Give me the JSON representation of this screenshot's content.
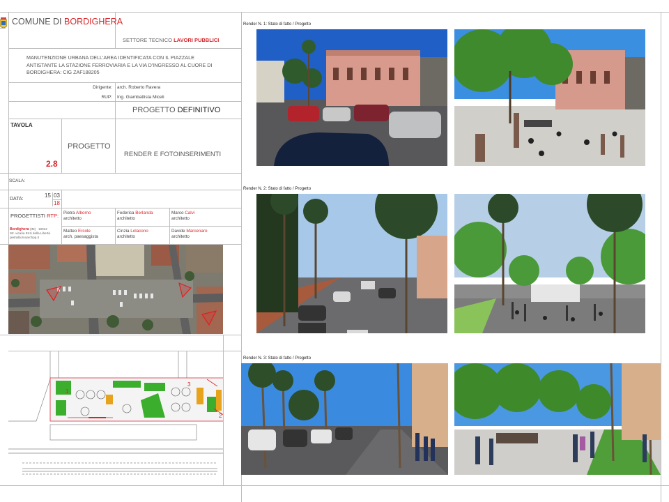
{
  "titleblock": {
    "comune_prefix": "COMUNE DI",
    "comune_name": "BORDIGHERA",
    "settore_prefix": "SETTORE TECNICO",
    "settore_name": "LAVORI PUBBLICI",
    "description_lines": [
      "MANUTENZIONE URBANA DELL'AREA IDENTIFICATA CON IL PIAZZALE",
      "ANTISTANTE LA STAZIONE FERROVIARIA E LA VIA D'INGRESSO AL CUORE DI",
      "BORDIGHERA:     CIG ZAF188205"
    ],
    "dirigente_label": "Dirigente:",
    "dirigente_value": "arch. Roberto Ravera",
    "rup_label": "RUP:",
    "rup_value": "Ing. Giambattista Miceli",
    "progetto_prefix": "PROGETTO",
    "progetto_type": "DEFINITIVO",
    "tavola_label": "TAVOLA",
    "tavola_number": "2.8",
    "section_label": "PROGETTO",
    "render_label": "RENDER E FOTOINSERIMENTI",
    "scala_label": "SCALA:",
    "data_label": "DATA:",
    "data_day": "15",
    "data_month": "03",
    "data_year": "18",
    "progettisti_label": "PROGETTISTI",
    "rtp_label": "RTP:",
    "designers": [
      {
        "first": "Pietra",
        "last": "Alborno",
        "role": "architetto"
      },
      {
        "first": "Federica",
        "last": "Berlanda",
        "role": "architetto"
      },
      {
        "first": "Marco",
        "last": "Calvi",
        "role": "architetto"
      },
      {
        "first": "Matteo",
        "last": "Ercole",
        "role": "arch. paesaggista"
      },
      {
        "first": "Cinzia",
        "last": "Lolacono",
        "role": "architetto"
      },
      {
        "first": "Davide",
        "last": "Marcenaro",
        "role": "architetto"
      }
    ],
    "office_city": "Bordighera",
    "office_prov": "(IM)",
    "office_cap": "18012",
    "office_address": "Str. vicaria Enzi della Libertà",
    "office_email": "pietralbornoarchpp.it"
  },
  "renders": [
    {
      "caption": "Render N. 1: Stato di fatto / Progetto"
    },
    {
      "caption": "Render N. 2: Stato di fatto / Progetto"
    },
    {
      "caption": "Render N. 3: Stato di fatto / Progetto"
    }
  ],
  "plan_markers": [
    "1",
    "2",
    "3"
  ]
}
